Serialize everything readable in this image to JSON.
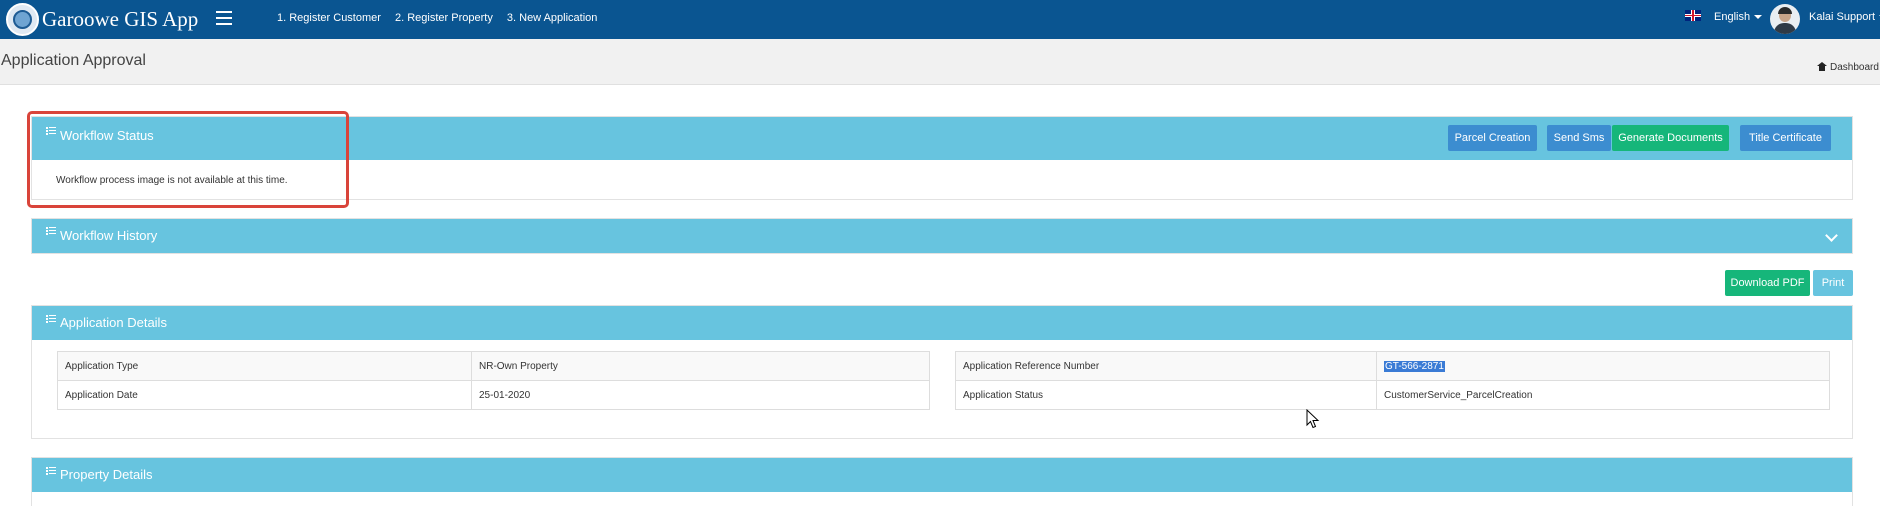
{
  "navbar": {
    "brand": "Garoowe GIS App",
    "links": [
      "1. Register Customer",
      "2. Register Property",
      "3. New Application"
    ],
    "language": "English",
    "user": "Kalai Support"
  },
  "page": {
    "title": "Application Approval",
    "breadcrumb": "Dashboard"
  },
  "workflow_status": {
    "title": "Workflow Status",
    "buttons": {
      "parcel_creation": "Parcel Creation",
      "send_sms": "Send Sms",
      "generate_documents": "Generate Documents",
      "title_certificate": "Title Certificate"
    },
    "message": "Workflow process image is not available at this time."
  },
  "workflow_history": {
    "title": "Workflow History"
  },
  "actions": {
    "download_pdf": "Download PDF",
    "print": "Print"
  },
  "application_details": {
    "title": "Application Details",
    "left": [
      {
        "label": "Application Type",
        "value": "NR-Own Property"
      },
      {
        "label": "Application Date",
        "value": "25-01-2020"
      }
    ],
    "right": [
      {
        "label": "Application Reference Number",
        "value": "GT-566-2871"
      },
      {
        "label": "Application Status",
        "value": "CustomerService_ParcelCreation"
      }
    ]
  },
  "property_details": {
    "title": "Property Details"
  },
  "colors": {
    "navbar": "#0a5591",
    "panel_header": "#67c4df",
    "button_blue": "#3c8dd0",
    "button_green": "#16b67a",
    "highlight": "#d9443a"
  }
}
